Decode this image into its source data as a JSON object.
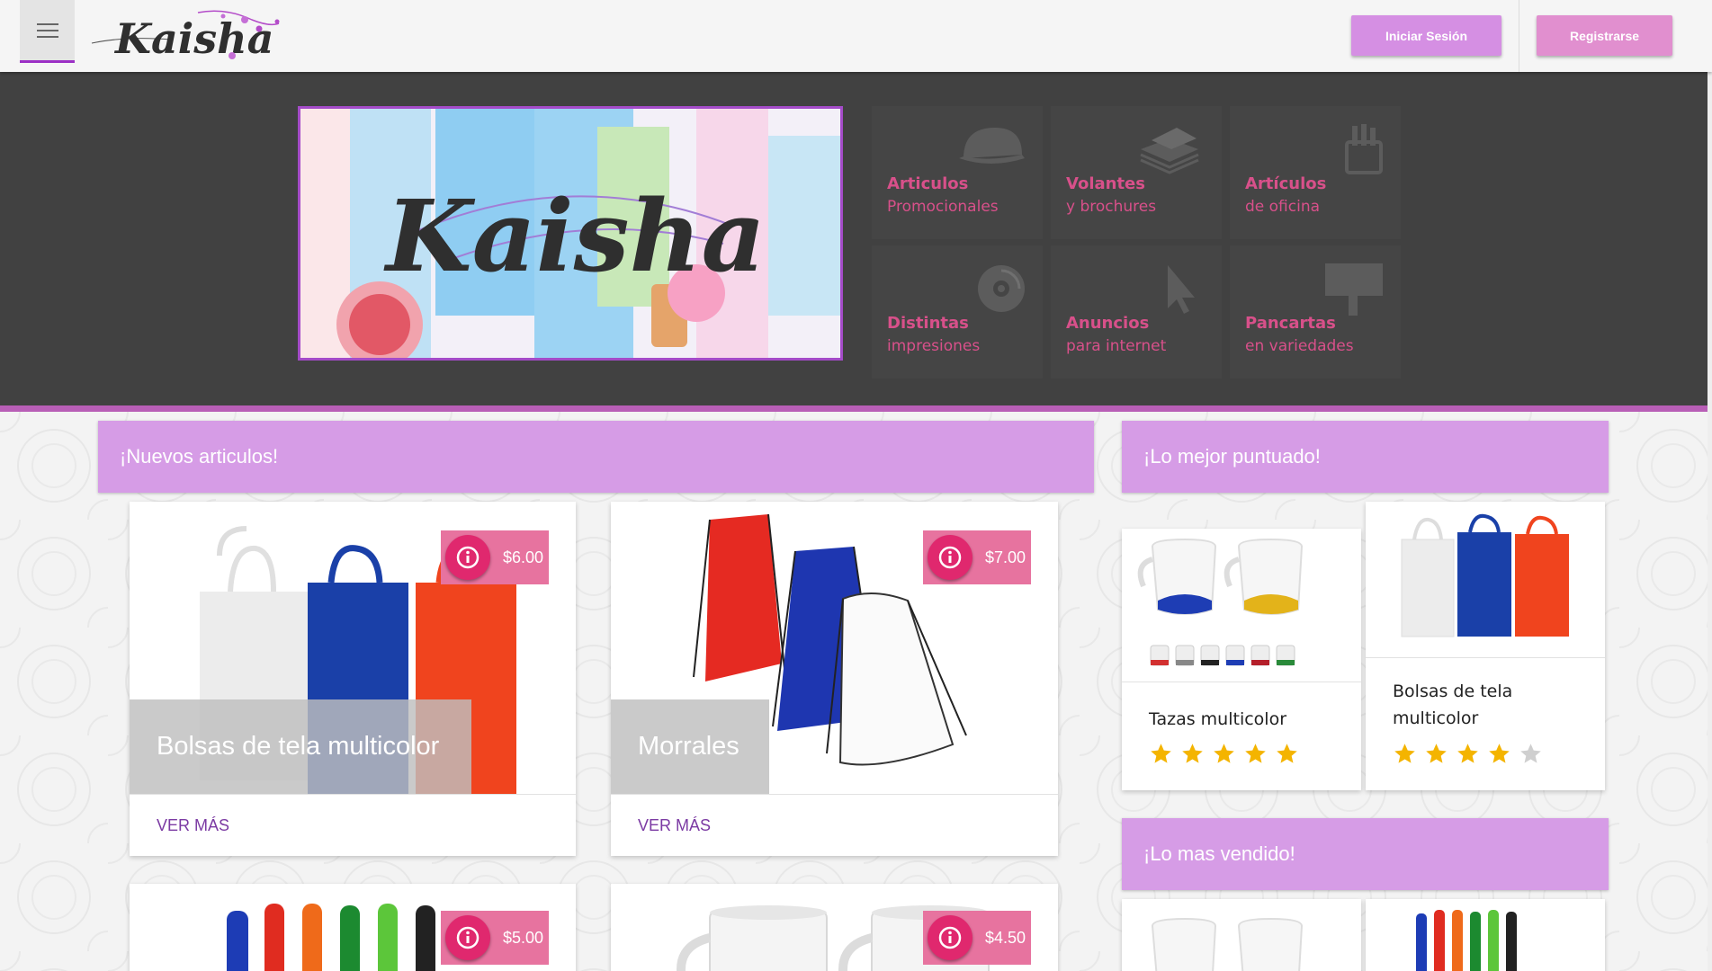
{
  "header": {
    "menu_icon": "hamburger-menu-icon",
    "logo_text": "Kaisha",
    "login_label": "Iniciar Sesión",
    "register_label": "Registrarse"
  },
  "hero": {
    "banner_text": "Kaisha",
    "tiles": [
      {
        "line1": "Articulos",
        "line2": "Promocionales",
        "icon": "cap-icon"
      },
      {
        "line1": "Volantes",
        "line2": "y brochures",
        "icon": "papers-icon"
      },
      {
        "line1": "Artículos",
        "line2": "de oficina",
        "icon": "pencil-cup-icon"
      },
      {
        "line1": "Distintas",
        "line2": "impresiones",
        "icon": "disc-icon"
      },
      {
        "line1": "Anuncios",
        "line2": "para internet",
        "icon": "cursor-icon"
      },
      {
        "line1": "Pancartas",
        "line2": "en variedades",
        "icon": "billboard-icon"
      }
    ]
  },
  "colors": {
    "accent": "#d69ce6",
    "badge": "#e7739f",
    "badge_icon": "#e0286e",
    "tile_text": "#d8508a",
    "link": "#7b3aa3",
    "star": "#f4b400"
  },
  "new_items": {
    "title": "¡Nuevos articulos!",
    "more_label": "VER MÁS",
    "products": [
      {
        "name": "Bolsas de tela multicolor",
        "price": "$6.00"
      },
      {
        "name": "Morrales",
        "price": "$7.00"
      },
      {
        "name": "",
        "price": "$5.00"
      },
      {
        "name": "",
        "price": "$4.50"
      }
    ]
  },
  "top_rated": {
    "title": "¡Lo mejor puntuado!",
    "items": [
      {
        "name": "Tazas multicolor",
        "rating": 5,
        "max": 5
      },
      {
        "name_line1": "Bolsas de tela",
        "name_line2": "multicolor",
        "rating": 4,
        "max": 5
      }
    ]
  },
  "best_sellers": {
    "title": "¡Lo mas vendido!"
  }
}
